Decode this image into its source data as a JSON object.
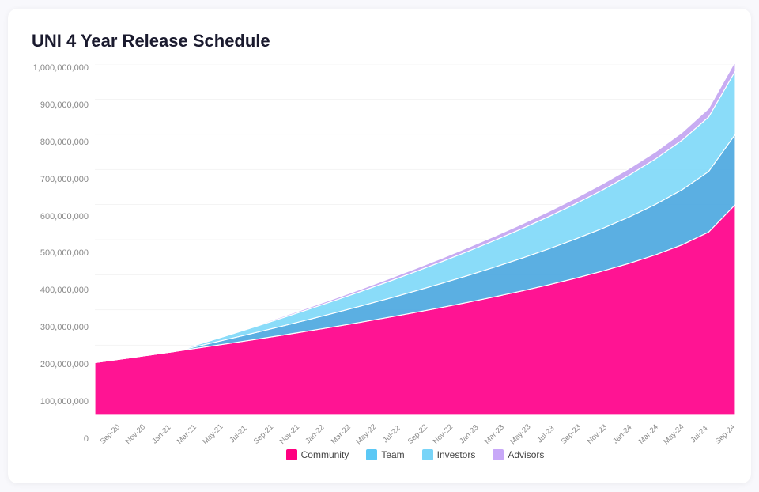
{
  "title": "UNI 4 Year Release Schedule",
  "yAxis": {
    "labels": [
      "1,000,000,000",
      "900,000,000",
      "800,000,000",
      "700,000,000",
      "600,000,000",
      "500,000,000",
      "400,000,000",
      "300,000,000",
      "200,000,000",
      "100,000,000",
      "0"
    ]
  },
  "xAxis": {
    "labels": [
      "Sep-20",
      "Nov-20",
      "Jan-21",
      "Mar-21",
      "May-21",
      "Jul-21",
      "Sep-21",
      "Nov-21",
      "Jan-22",
      "Mar-22",
      "May-22",
      "Jul-22",
      "Sep-22",
      "Nov-22",
      "Jan-23",
      "Mar-23",
      "May-23",
      "Jul-23",
      "Sep-23",
      "Nov-23",
      "Jan-24",
      "Mar-24",
      "May-24",
      "Jul-24",
      "Sep-24"
    ]
  },
  "legend": [
    {
      "label": "Community",
      "color": "#FF0080"
    },
    {
      "label": "Team",
      "color": "#5BC8F5"
    },
    {
      "label": "Investors",
      "color": "#78D4F8"
    },
    {
      "label": "Advisors",
      "color": "#C8A8F8"
    }
  ],
  "colors": {
    "community": "#FF0080",
    "team": "#4EAEE8",
    "investors": "#7DCEF5",
    "advisors": "#C0A0F0"
  }
}
